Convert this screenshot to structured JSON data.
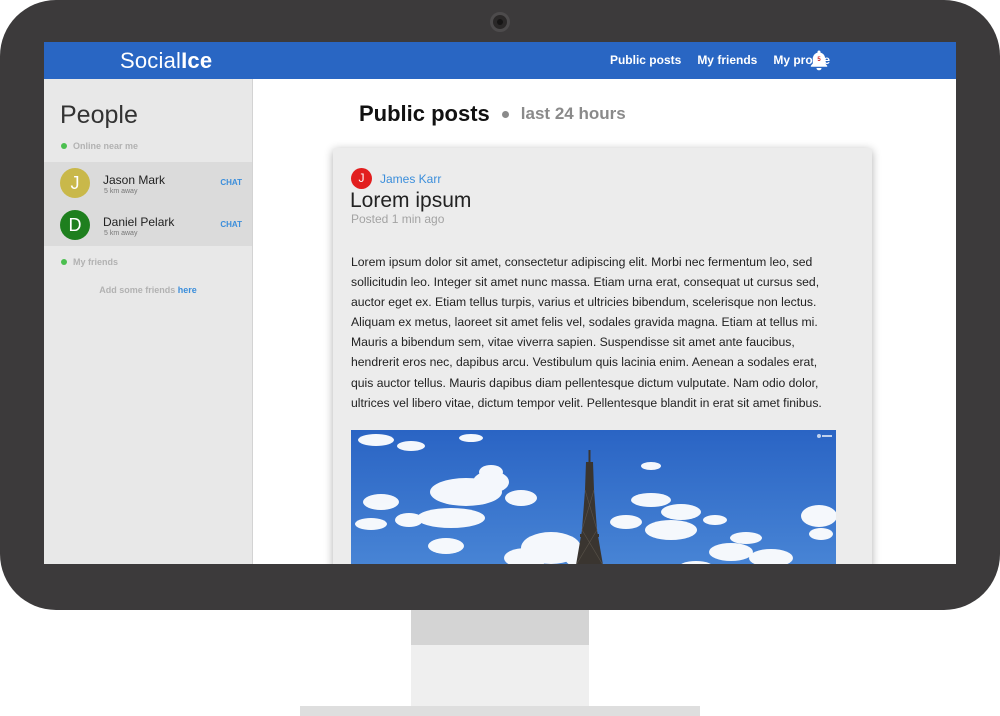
{
  "app": {
    "brand_light": "Social",
    "brand_bold": "Ice",
    "nav": {
      "public_posts": "Public posts",
      "my_friends": "My friends",
      "my_profile": "My profile"
    },
    "notification_count": "5",
    "accent_color": "#2966c3"
  },
  "sidebar": {
    "title": "People",
    "online_label": "Online near me",
    "people": [
      {
        "initial": "J",
        "name": "Jason Mark",
        "distance": "5 km away",
        "action": "CHAT",
        "avatar_color": "#c9b84a"
      },
      {
        "initial": "D",
        "name": "Daniel Pelark",
        "distance": "5 km away",
        "action": "CHAT",
        "avatar_color": "#1e7f1e"
      }
    ],
    "friends_label": "My friends",
    "add_friends_text": "Add some friends",
    "add_friends_link": "here"
  },
  "main": {
    "title": "Public posts",
    "subtitle": "last 24 hours"
  },
  "post": {
    "author_initial": "J",
    "author": "James Karr",
    "title": "Lorem ipsum",
    "time": "Posted 1 min ago",
    "body": "Lorem ipsum dolor sit amet, consectetur adipiscing elit. Morbi nec fermentum leo, sed sollicitudin leo. Integer sit amet nunc massa. Etiam urna erat, consequat ut cursus sed, auctor eget ex. Etiam tellus turpis, varius et ultricies bibendum, scelerisque non lectus. Aliquam ex metus, laoreet sit amet felis vel, sodales gravida magna. Etiam at tellus mi. Mauris a bibendum sem, vitae viverra sapien. Suspendisse sit amet ante faucibus, hendrerit eros nec, dapibus arcu. Vestibulum quis lacinia enim. Aenean a sodales erat, quis auctor tellus. Mauris dapibus diam pellentesque dictum vulputate. Nam odio dolor, ultrices vel libero vitae, dictum tempor velit. Pellentesque blandit in erat sit amet finibus.",
    "image_subject": "eiffel-tower-sky"
  }
}
